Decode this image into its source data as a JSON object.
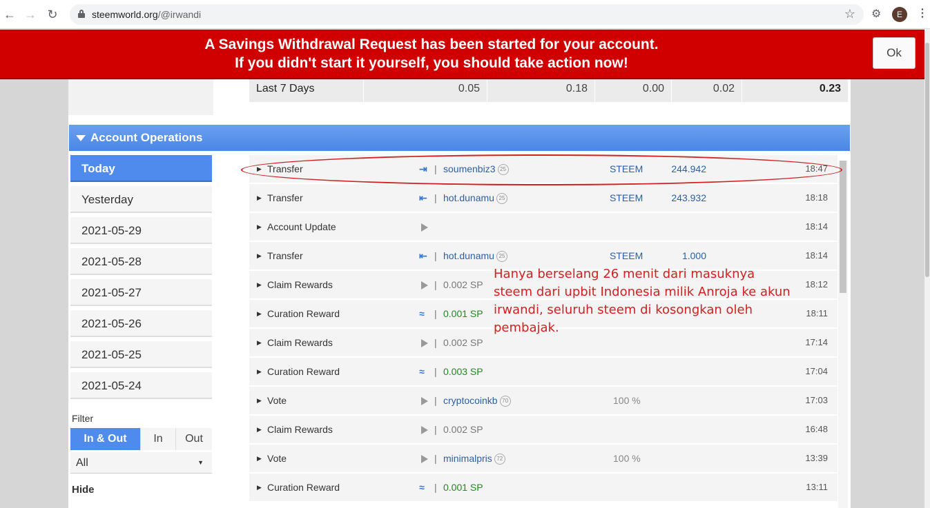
{
  "browser": {
    "url_host": "steemworld.org",
    "url_path": "/@irwandi",
    "profile_initial": "E"
  },
  "alert": {
    "line1": "A Savings Withdrawal Request has been started for your account.",
    "line2": "If you didn't start it yourself, you should take action now!",
    "ok_label": "Ok"
  },
  "stats": {
    "label": "Last 7 Days",
    "values": [
      "0.05",
      "0.18",
      "0.00",
      "0.02",
      "0.23"
    ]
  },
  "operations_header": "Account Operations",
  "dates": [
    "Today",
    "Yesterday",
    "2021-05-29",
    "2021-05-28",
    "2021-05-27",
    "2021-05-26",
    "2021-05-25",
    "2021-05-24"
  ],
  "filter": {
    "label": "Filter",
    "tabs": [
      "In & Out",
      "In",
      "Out"
    ],
    "select_value": "All",
    "hide_label": "Hide"
  },
  "operations": [
    {
      "type": "Transfer",
      "icon": "transfer-in-icon",
      "who": "soumenbiz3",
      "rep": "25",
      "currency": "STEEM",
      "amount": "244.942",
      "time": "18:47"
    },
    {
      "type": "Transfer",
      "icon": "transfer-out-icon",
      "who": "hot.dunamu",
      "rep": "25",
      "currency": "STEEM",
      "amount": "243.932",
      "time": "18:18"
    },
    {
      "type": "Account Update",
      "icon": "play-icon",
      "time": "18:14"
    },
    {
      "type": "Transfer",
      "icon": "transfer-out-icon",
      "who": "hot.dunamu",
      "rep": "25",
      "currency": "STEEM",
      "amount": "1.000",
      "time": "18:14"
    },
    {
      "type": "Claim Rewards",
      "icon": "play-icon",
      "sp": "0.002 SP",
      "time": "18:12"
    },
    {
      "type": "Curation Reward",
      "icon": "steem-icon",
      "sp": "0.001 SP",
      "time": "18:11"
    },
    {
      "type": "Claim Rewards",
      "icon": "play-icon",
      "sp": "0.002 SP",
      "time": "17:14"
    },
    {
      "type": "Curation Reward",
      "icon": "steem-icon",
      "sp": "0.003 SP",
      "time": "17:04"
    },
    {
      "type": "Vote",
      "icon": "play-icon",
      "who": "cryptocoinkb",
      "rep": "70",
      "percent": "100 %",
      "time": "17:03"
    },
    {
      "type": "Claim Rewards",
      "icon": "play-icon",
      "sp": "0.002 SP",
      "time": "16:48"
    },
    {
      "type": "Vote",
      "icon": "play-icon",
      "who": "minimalpris",
      "rep": "72",
      "percent": "100 %",
      "time": "13:39"
    },
    {
      "type": "Curation Reward",
      "icon": "steem-icon",
      "sp": "0.001 SP",
      "time": "13:11"
    }
  ],
  "annotation": "Hanya berselang 26 menit dari masuknya steem dari upbit Indonesia milik Anroja ke akun irwandi, seluruh steem di kosongkan oleh pembajak.",
  "colors": {
    "alert_bg": "#d10000",
    "accent_blue": "#4f8bec",
    "link_blue": "#2a5fa8",
    "annotation_red": "#d42020"
  }
}
